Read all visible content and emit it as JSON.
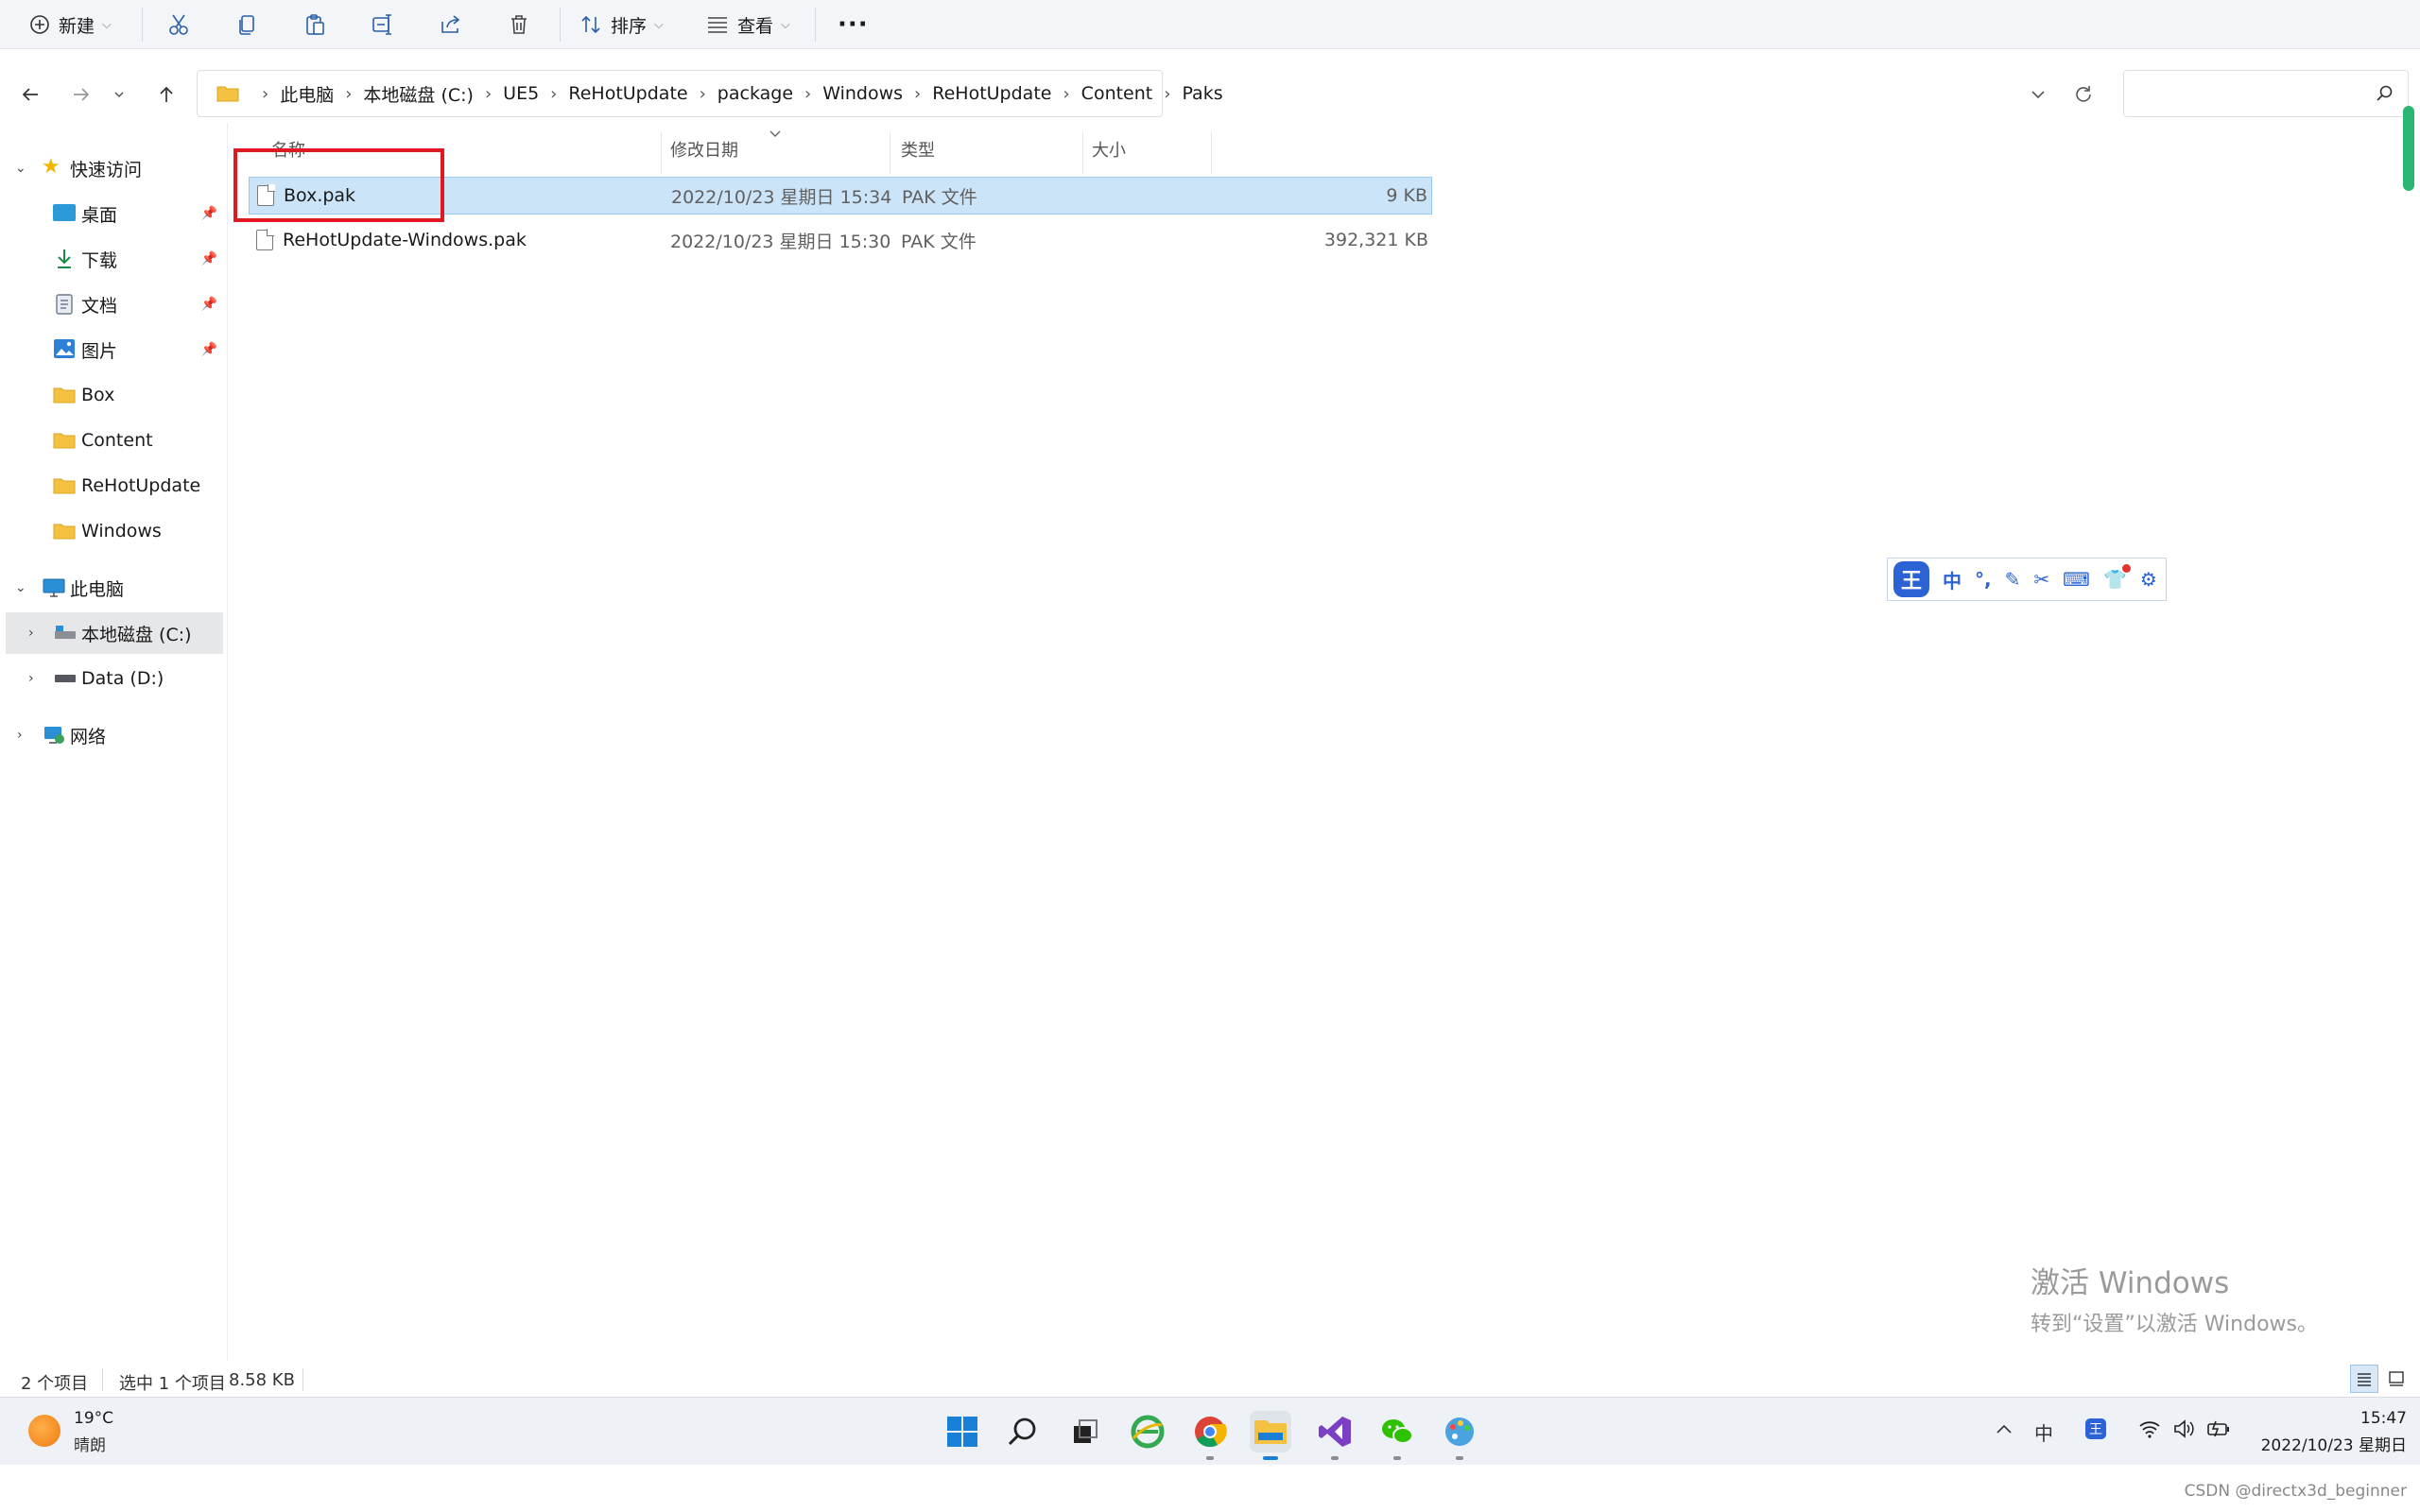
{
  "toolbar": {
    "new_label": "新建",
    "sort_label": "排序",
    "view_label": "查看",
    "more_label": "···"
  },
  "address": {
    "crumbs": [
      "此电脑",
      "本地磁盘 (C:)",
      "UE5",
      "ReHotUpdate",
      "package",
      "Windows",
      "ReHotUpdate",
      "Content",
      "Paks"
    ],
    "search_placeholder": ""
  },
  "nav": {
    "quick_access": "快速访问",
    "pinned": [
      "桌面",
      "下载",
      "文档",
      "图片"
    ],
    "recent": [
      "Box",
      "Content",
      "ReHotUpdate",
      "Windows"
    ],
    "this_pc": "此电脑",
    "drive_c": "本地磁盘 (C:)",
    "drive_d": "Data (D:)",
    "network": "网络"
  },
  "columns": {
    "name": "名称",
    "date": "修改日期",
    "type": "类型",
    "size": "大小"
  },
  "files": [
    {
      "name": "Box.pak",
      "date": "2022/10/23 星期日 15:34",
      "type": "PAK 文件",
      "size": "9 KB",
      "selected": true
    },
    {
      "name": "ReHotUpdate-Windows.pak",
      "date": "2022/10/23 星期日 15:30",
      "type": "PAK 文件",
      "size": "392,321 KB",
      "selected": false
    }
  ],
  "status": {
    "count": "2 个项目",
    "selection": "选中 1 个项目",
    "size": "8.58 KB"
  },
  "ime": {
    "logo": "王",
    "mode": "中",
    "punct": "°,"
  },
  "watermark": {
    "title": "激活 Windows",
    "subtitle": "转到“设置”以激活 Windows。"
  },
  "taskbar": {
    "weather_temp": "19°C",
    "weather_desc": "晴朗",
    "tray_lang": "中",
    "time": "15:47",
    "date": "2022/10/23 星期日"
  },
  "footer_credit": "CSDN @directx3d_beginner",
  "colors": {
    "accent": "#0067c0",
    "selection": "#cce4f7",
    "highlight_box": "#e0181f"
  }
}
